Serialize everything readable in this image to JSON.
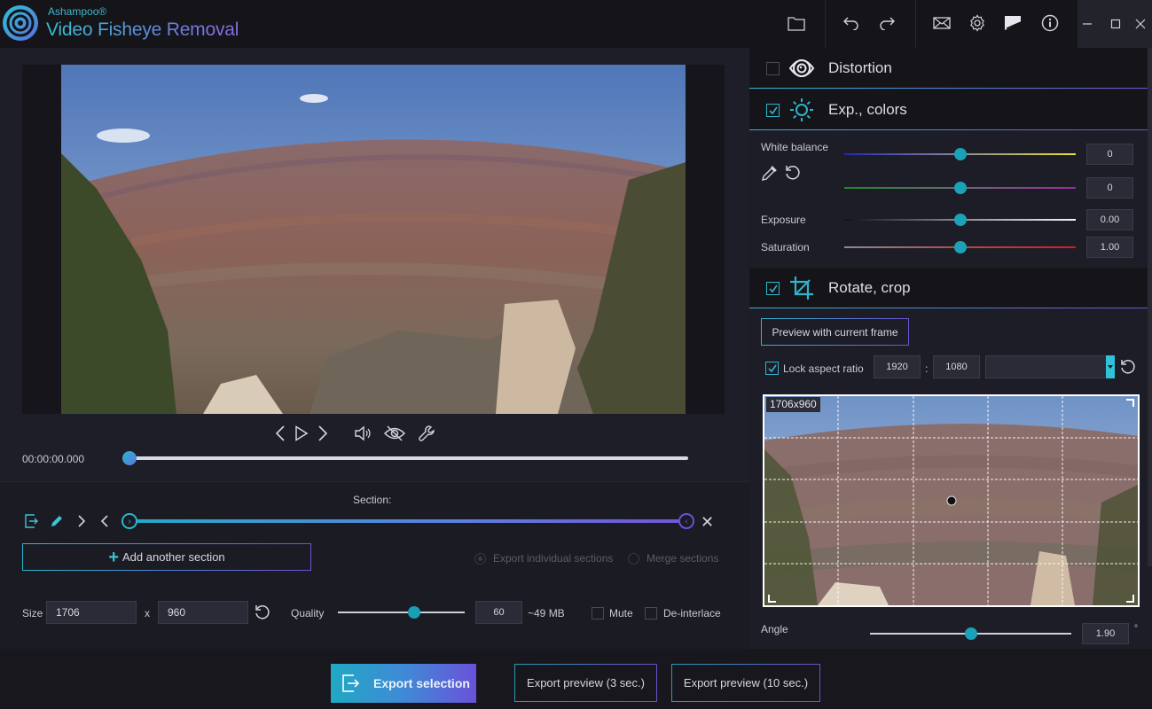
{
  "app": {
    "brand": "Ashampoo®",
    "title": "Video Fisheye Removal"
  },
  "toolbar": {
    "icons": [
      "folder-icon",
      "undo-icon",
      "redo-icon",
      "mail-icon",
      "gear-icon",
      "skin-icon",
      "info-icon"
    ],
    "window": [
      "minimize",
      "maximize",
      "close"
    ]
  },
  "player": {
    "time": "00:00:00.000",
    "position_fraction": 0.0
  },
  "section": {
    "label": "Section:",
    "start_fraction": 0.0,
    "end_fraction": 1.0,
    "add_label": "Add another section",
    "export_individual": "Export individual sections",
    "merge": "Merge sections",
    "export_individual_selected": true
  },
  "output": {
    "size_label": "Size",
    "width": "1706",
    "x_label": "x",
    "height": "960",
    "quality_label": "Quality",
    "quality_value": "60",
    "quality_fraction": 0.6,
    "estimated_size": "~49 MB",
    "mute_label": "Mute",
    "mute_checked": false,
    "deinterlace_label": "De-interlace",
    "deinterlace_checked": false
  },
  "export": {
    "main_label": "Export selection",
    "preview3_label": "Export preview (3 sec.)",
    "preview10_label": "Export preview (10 sec.)"
  },
  "panels": {
    "distortion": {
      "title": "Distortion",
      "checked": false
    },
    "colors": {
      "title": "Exp., colors",
      "checked": true,
      "white_balance_label": "White balance",
      "wb_blue_yellow": "0",
      "wb_green_magenta": "0",
      "exposure_label": "Exposure",
      "exposure": "0.00",
      "saturation_label": "Saturation",
      "saturation": "1.00",
      "slider_fraction": 0.5
    },
    "rotate": {
      "title": "Rotate, crop",
      "checked": true,
      "preview_label": "Preview with current frame",
      "lock_label": "Lock aspect ratio",
      "lock_checked": true,
      "ratio_w": "1920",
      "ratio_sep": ":",
      "ratio_h": "1080",
      "preset": "",
      "crop_size": "1706x960",
      "angle_label": "Angle",
      "angle": "1.90",
      "angle_unit": "°",
      "angle_fraction": 0.5
    }
  },
  "colors": {
    "accent_teal": "#2fb4cd",
    "accent_purple": "#6d52d6",
    "knob": "#1aa3b8"
  }
}
